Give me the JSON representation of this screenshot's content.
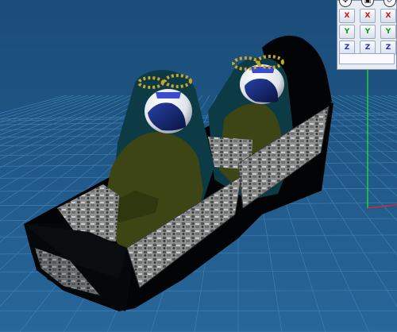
{
  "viewport": {
    "background": "#1f5685",
    "grid_color": "#3f7fb0",
    "y_axis_color": "#22ee22",
    "x_axis_color": "#ee2222"
  },
  "toolbar": {
    "tools": [
      {
        "name": "move-tool-icon"
      },
      {
        "name": "frame-tool-icon"
      },
      {
        "name": "rotate-tool-icon"
      }
    ]
  },
  "axis_panel": {
    "rows": [
      {
        "axis": "x",
        "labels": [
          "X",
          "X",
          "X"
        ],
        "color": "#d21414"
      },
      {
        "axis": "y",
        "labels": [
          "Y",
          "Y",
          "Y"
        ],
        "color": "#109a10"
      },
      {
        "axis": "z",
        "labels": [
          "Z",
          "Z",
          "Z"
        ],
        "color": "#1b2fc8"
      }
    ]
  },
  "model": {
    "parts": [
      "cockpit-tub",
      "front-ejection-seat",
      "rear-ejection-seat",
      "front-pilot",
      "rear-pilot",
      "front-helmet",
      "rear-helmet",
      "left-instrument-console",
      "right-instrument-console",
      "front-instrument-panel",
      "rear-instrument-panel"
    ],
    "colors": {
      "tub": "#020304",
      "seat": "#0c3b45",
      "flightsuit": "#3c4513",
      "helmet_white": "#f2f4f6",
      "visor": "#10205e",
      "console": "#8b8e8d",
      "seat_handle": "#c7a52a"
    }
  }
}
